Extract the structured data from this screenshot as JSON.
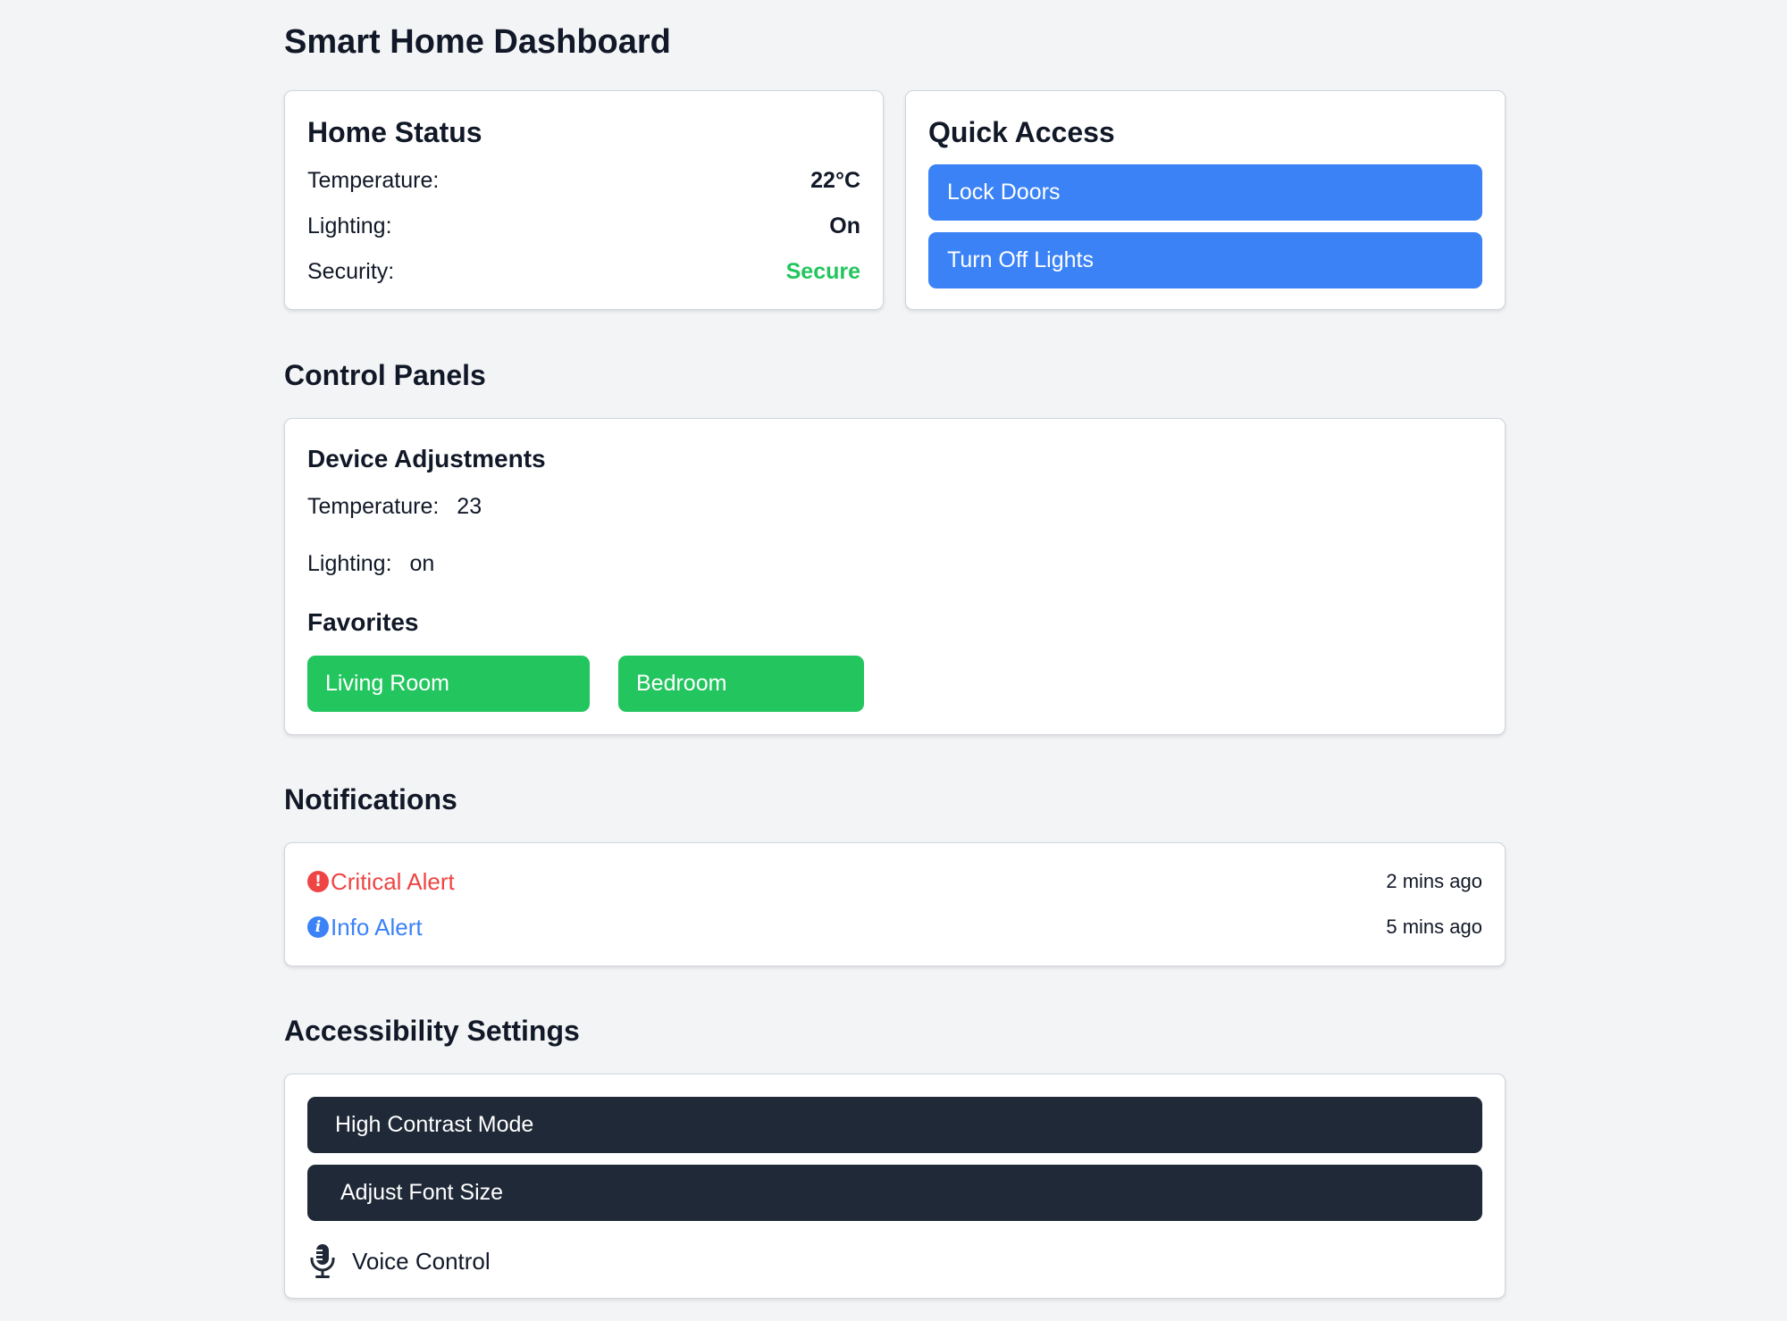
{
  "page": {
    "title": "Smart Home Dashboard"
  },
  "home_status": {
    "title": "Home Status",
    "rows": [
      {
        "label": "Temperature:",
        "value": "22°C"
      },
      {
        "label": "Lighting:",
        "value": "On"
      },
      {
        "label": "Security:",
        "value": "Secure",
        "value_color": "#22c55e"
      }
    ]
  },
  "quick_access": {
    "title": "Quick Access",
    "buttons": [
      "Lock Doors",
      "Turn Off Lights"
    ],
    "button_color": "#3b82f6"
  },
  "control_panels": {
    "section_title": "Control Panels",
    "device_adjustments": {
      "title": "Device Adjustments",
      "temperature": {
        "label": "Temperature:",
        "value": "23"
      },
      "lighting": {
        "label": "Lighting:",
        "value": "on"
      }
    },
    "favorites": {
      "title": "Favorites",
      "items": [
        "Living Room",
        "Bedroom"
      ],
      "color": "#22c55e"
    }
  },
  "notifications": {
    "section_title": "Notifications",
    "items": [
      {
        "icon": "exclamation-circle-icon",
        "label": "Critical Alert",
        "time": "2 mins ago",
        "color": "#ef4444"
      },
      {
        "icon": "info-circle-icon",
        "label": "Info Alert",
        "time": "5 mins ago",
        "color": "#3b82f6"
      }
    ]
  },
  "accessibility": {
    "section_title": "Accessibility Settings",
    "buttons": [
      "High Contrast Mode",
      "Adjust Font Size"
    ],
    "button_color": "#1f2937",
    "voice": {
      "icon": "microphone-icon",
      "label": "Voice Control"
    }
  }
}
